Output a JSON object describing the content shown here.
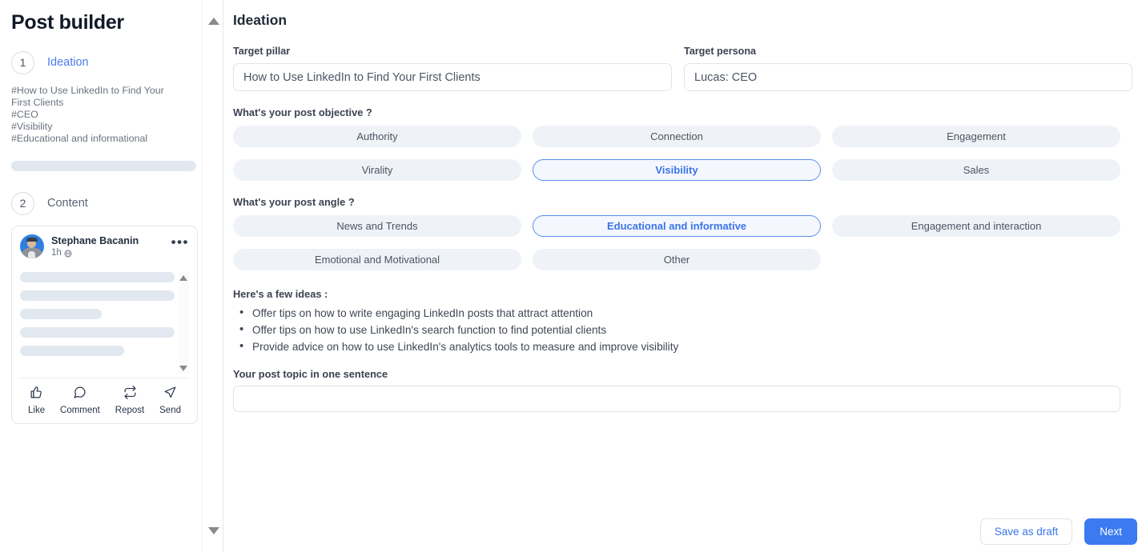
{
  "sidebar": {
    "app_title": "Post builder",
    "steps": [
      {
        "number": "1",
        "label": "Ideation"
      },
      {
        "number": "2",
        "label": "Content"
      }
    ],
    "tags": [
      "#How to Use LinkedIn to Find Your First Clients",
      "#CEO",
      "#Visibility",
      "#Educational and informational"
    ],
    "post_preview": {
      "author": "Stephane Bacanin",
      "time": "1h",
      "visibility_icon": "globe-icon",
      "more_icon": "more-options-icon",
      "actions": [
        {
          "icon": "thumbs-up-icon",
          "label": "Like"
        },
        {
          "icon": "comment-bubble-icon",
          "label": "Comment"
        },
        {
          "icon": "repost-icon",
          "label": "Repost"
        },
        {
          "icon": "send-paper-plane-icon",
          "label": "Send"
        }
      ]
    },
    "scroll_up_icon": "scroll-up-arrow-icon",
    "scroll_down_icon": "scroll-down-arrow-icon"
  },
  "main": {
    "title": "Ideation",
    "target_pillar": {
      "label": "Target pillar",
      "value": "How to Use LinkedIn to Find Your First Clients",
      "placeholder": "Target pillar"
    },
    "target_persona": {
      "label": "Target persona",
      "value": "Lucas: CEO",
      "placeholder": "Target persona"
    },
    "objective": {
      "label": "What's your post objective ?",
      "options": [
        {
          "label": "Authority",
          "selected": false
        },
        {
          "label": "Connection",
          "selected": false
        },
        {
          "label": "Engagement",
          "selected": false
        },
        {
          "label": "Virality",
          "selected": false
        },
        {
          "label": "Visibility",
          "selected": true
        },
        {
          "label": "Sales",
          "selected": false
        }
      ]
    },
    "angle": {
      "label": "What's your post angle ?",
      "options": [
        {
          "label": "News and Trends",
          "selected": false
        },
        {
          "label": "Educational and informative",
          "selected": true
        },
        {
          "label": "Engagement and interaction",
          "selected": false
        },
        {
          "label": "Emotional and Motivational",
          "selected": false
        },
        {
          "label": "Other",
          "selected": false
        }
      ]
    },
    "ideas": {
      "title": "Here's a few ideas :",
      "items": [
        "Offer tips on how to write engaging LinkedIn posts that attract attention",
        "Offer tips on how to use LinkedIn's search function to find potential clients",
        "Provide advice on how to use LinkedIn's analytics tools to measure and improve visibility"
      ]
    },
    "topic": {
      "label": "Your post topic in one sentence",
      "value": "",
      "placeholder": ""
    },
    "footer": {
      "save_label": "Save as draft",
      "next_label": "Next"
    }
  },
  "colors": {
    "accent_blue": "#3b7af0",
    "selected_border": "#5b8def",
    "chip_bg": "#eff2f7",
    "skeleton": "#e2e8f0"
  }
}
